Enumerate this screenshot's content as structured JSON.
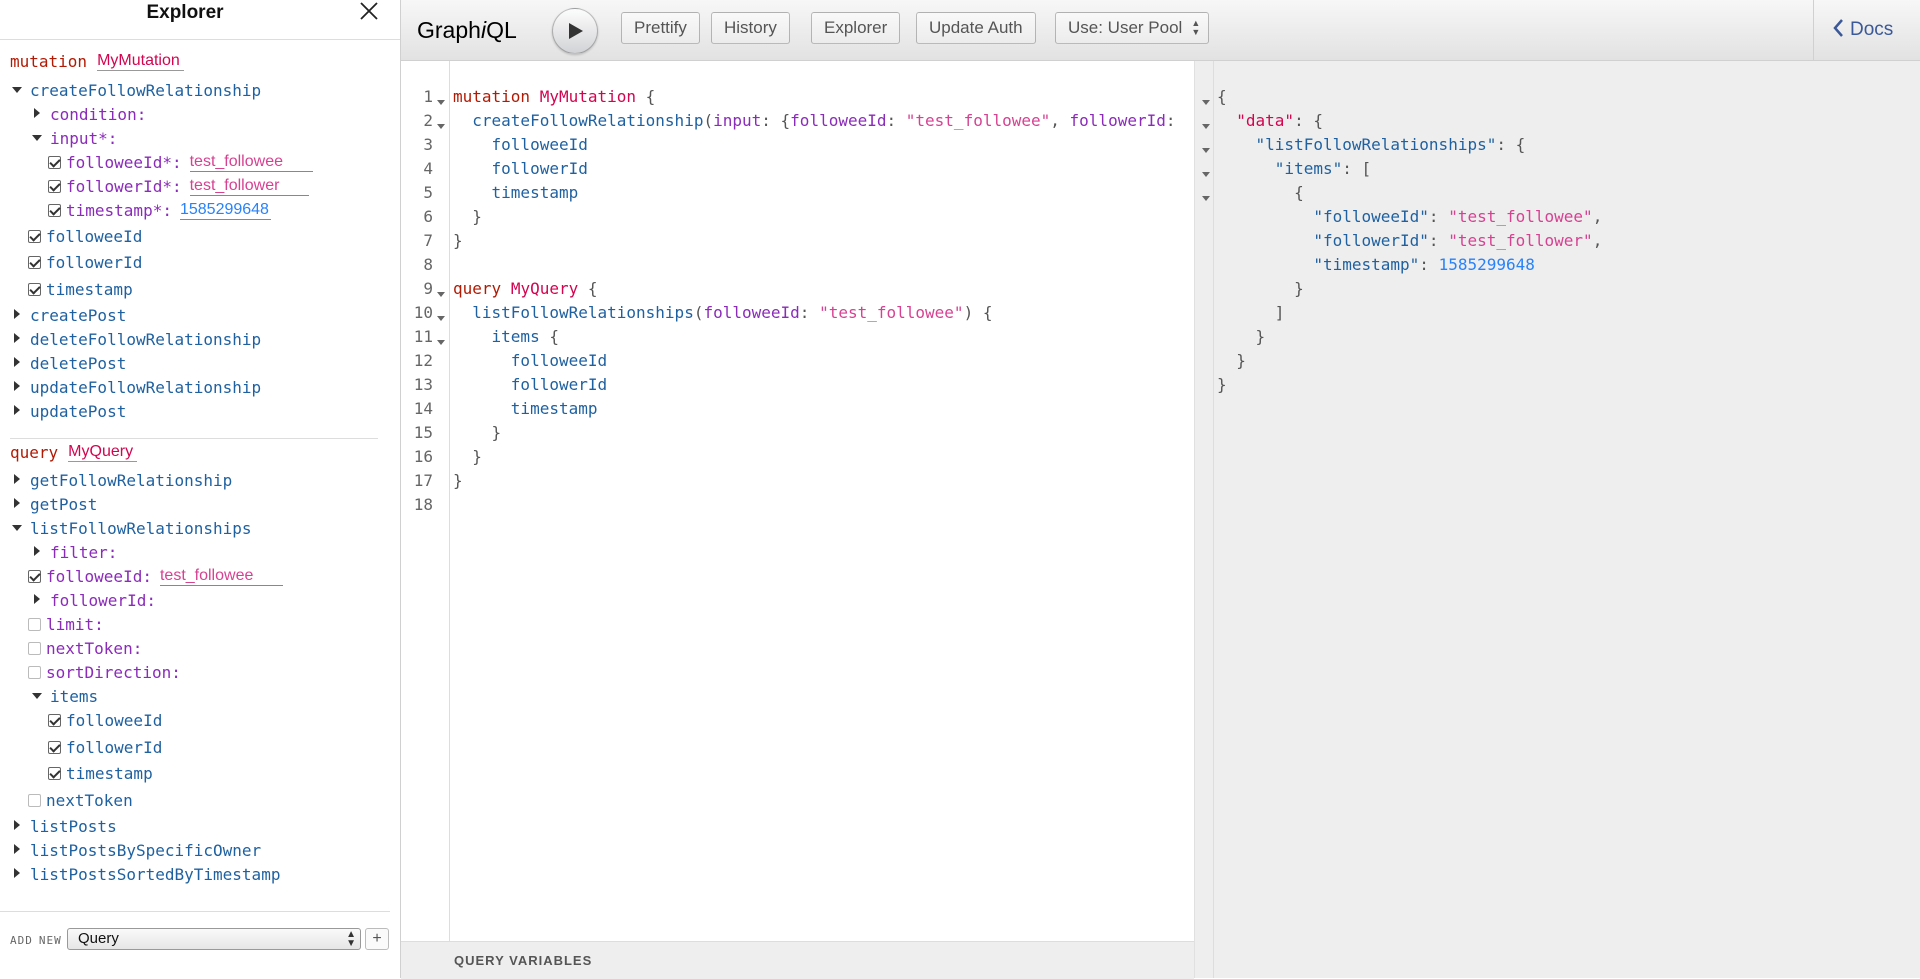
{
  "explorer": {
    "title": "Explorer",
    "mutation": {
      "keyword": "mutation",
      "name": "MyMutation",
      "field": "createFollowRelationship",
      "args": {
        "condition": "condition:",
        "input": "input*:",
        "followeeId_label": "followeeId*:",
        "followeeId_value": "test_followee",
        "followerId_label": "followerId*:",
        "followerId_value": "test_follower",
        "timestamp_label": "timestamp*:",
        "timestamp_value": "1585299648"
      },
      "selected_fields": [
        "followeeId",
        "followerId",
        "timestamp"
      ],
      "other_fields": [
        "createPost",
        "deleteFollowRelationship",
        "deletePost",
        "updateFollowRelationship",
        "updatePost"
      ]
    },
    "query": {
      "keyword": "query",
      "name": "MyQuery",
      "fields_before": [
        "getFollowRelationship",
        "getPost"
      ],
      "field": "listFollowRelationships",
      "args": {
        "filter": "filter:",
        "followeeId_label": "followeeId:",
        "followeeId_value": "test_followee",
        "followerId": "followerId:",
        "limit": "limit:",
        "nextToken": "nextToken:",
        "sortDirection": "sortDirection:"
      },
      "items_label": "items",
      "items_fields": [
        "followeeId",
        "followerId",
        "timestamp"
      ],
      "next_token": "nextToken",
      "fields_after": [
        "listPosts",
        "listPostsBySpecificOwner",
        "listPostsSortedByTimestamp"
      ]
    },
    "add_label": "ADD",
    "new_label": "NEW",
    "operation_type": "Query",
    "add_button": "+"
  },
  "toolbar": {
    "logo_pre": "Graph",
    "logo_i": "i",
    "logo_post": "QL",
    "prettify": "Prettify",
    "history": "History",
    "explorer": "Explorer",
    "update_auth": "Update Auth",
    "auth_mode": "Use: User Pool",
    "docs": "Docs"
  },
  "editor": {
    "line_numbers": [
      "1",
      "2",
      "3",
      "4",
      "5",
      "6",
      "7",
      "8",
      "9",
      "10",
      "11",
      "12",
      "13",
      "14",
      "15",
      "16",
      "17",
      "18"
    ],
    "variables_title": "QUERY VARIABLES"
  },
  "code": {
    "l1_kw": "mutation",
    "l1_name": "MyMutation",
    "l1_punc": " {",
    "l2_field": "createFollowRelationship",
    "l2_open": "(",
    "l2_arg": "input",
    "l2_colon": ": {",
    "l2_arg2": "followeeId",
    "l2_colon2": ": ",
    "l2_str": "\"test_followee\"",
    "l2_comma": ", ",
    "l2_arg3": "followerId",
    "l2_colon3": ":",
    "l3": "followeeId",
    "l4": "followerId",
    "l5": "timestamp",
    "l6": "}",
    "l7": "}",
    "l9_kw": "query",
    "l9_name": "MyQuery",
    "l9_punc": " {",
    "l10_field": "listFollowRelationships",
    "l10_open": "(",
    "l10_arg": "followeeId",
    "l10_colon": ": ",
    "l10_str": "\"test_followee\"",
    "l10_close": ") {",
    "l11_field": "items",
    "l11_punc": " {",
    "l12": "followeeId",
    "l13": "followerId",
    "l14": "timestamp",
    "l15": "}",
    "l16": "}",
    "l17": "}"
  },
  "result": {
    "open": "{",
    "data_key": "\"data\"",
    "list_key": "\"listFollowRelationships\"",
    "items_key": "\"items\"",
    "k_followee": "\"followeeId\"",
    "v_followee": "\"test_followee\"",
    "k_follower": "\"followerId\"",
    "v_follower": "\"test_follower\"",
    "k_timestamp": "\"timestamp\"",
    "v_timestamp": "1585299648"
  }
}
